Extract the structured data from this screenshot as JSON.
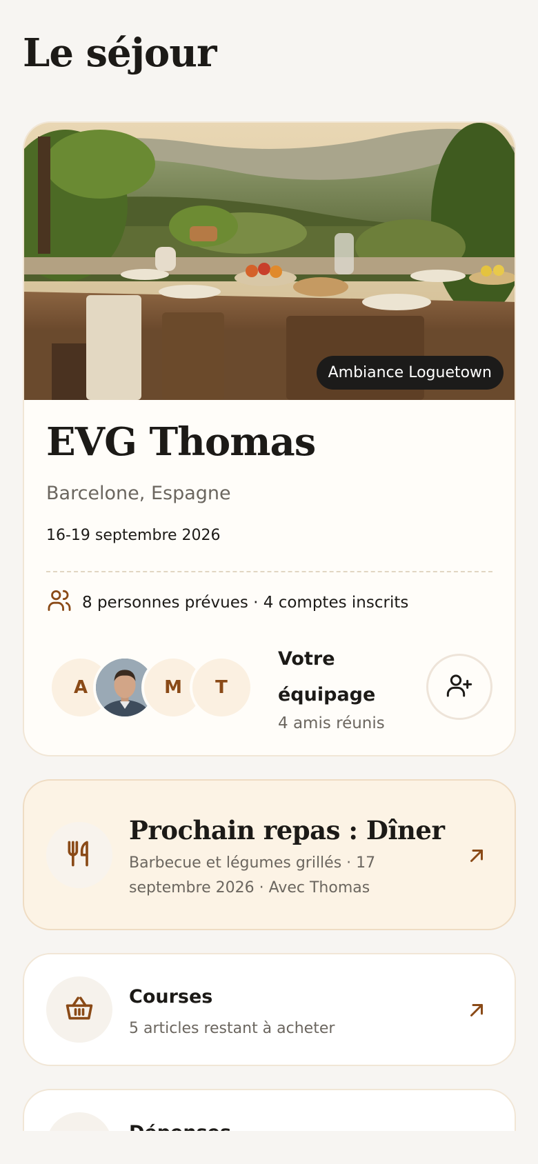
{
  "header": {
    "title": "Le séjour"
  },
  "trip": {
    "hero_badge": "Ambiance Loguetown",
    "name": "EVG Thomas",
    "location": "Barcelone, Espagne",
    "dates": "16-19 septembre 2026",
    "people_summary": "8 personnes prévues · 4 comptes inscrits",
    "team": {
      "title": "Votre équipage",
      "subtitle": "4 amis réunis",
      "avatars": [
        "A",
        "photo",
        "M",
        "T"
      ]
    }
  },
  "meal": {
    "title": "Prochain repas : Dîner",
    "subtitle": "Barbecue et légumes grillés · 17 septembre 2026 · Avec Thomas"
  },
  "shopping": {
    "title": "Courses",
    "subtitle": "5 articles restant à acheter"
  },
  "expenses": {
    "title": "Dépenses"
  },
  "colors": {
    "accent": "#8a4a17",
    "background": "#f7f5f2",
    "meal_tile": "#fcf3e5"
  },
  "icons": [
    "users-icon",
    "user-plus-icon",
    "utensils-icon",
    "basket-icon",
    "arrow-up-right-icon"
  ]
}
